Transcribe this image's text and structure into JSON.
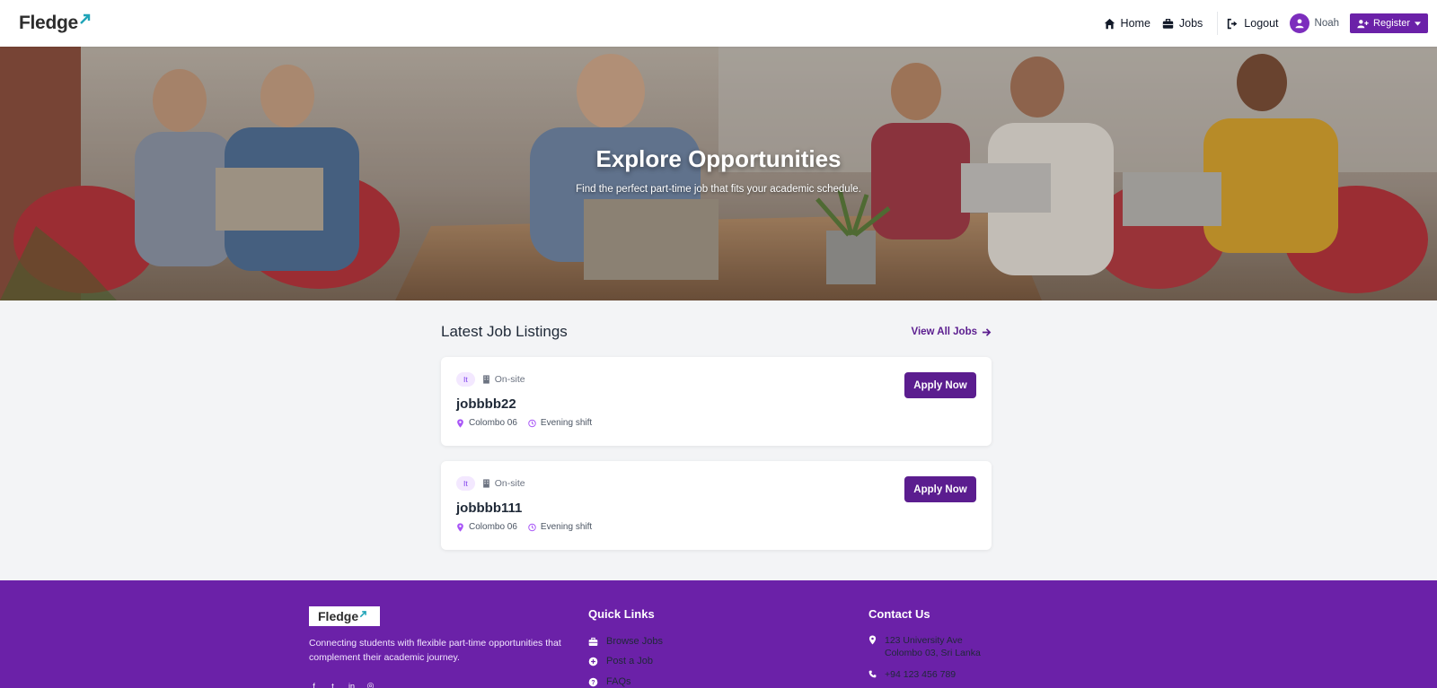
{
  "brand": {
    "name": "Fledge",
    "color": "#2d2d2d",
    "accent": "#20a4b8"
  },
  "nav": {
    "home_label": "Home",
    "jobs_label": "Jobs",
    "logout_label": "Logout",
    "user_name": "Noah",
    "register_label": "Register"
  },
  "hero": {
    "title": "Explore Opportunities",
    "subtitle": "Find the perfect part-time job that fits your academic schedule."
  },
  "listings": {
    "title": "Latest Job Listings",
    "view_all_label": "View All Jobs",
    "jobs": [
      {
        "category": "It",
        "mode": "On-site",
        "title": "jobbbb22",
        "location": "Colombo 06",
        "shift": "Evening shift",
        "apply_label": "Apply Now"
      },
      {
        "category": "It",
        "mode": "On-site",
        "title": "jobbbb111",
        "location": "Colombo 06",
        "shift": "Evening shift",
        "apply_label": "Apply Now"
      }
    ]
  },
  "footer": {
    "logo": "Fledge",
    "description": "Connecting students with flexible part-time opportunities that complement their academic journey.",
    "quick_links_title": "Quick Links",
    "quick_links": [
      "Browse Jobs",
      "Post a Job",
      "FAQs"
    ],
    "contact_title": "Contact Us",
    "address_line1": "123 University Ave",
    "address_line2": "Colombo 03, Sri Lanka",
    "phone": "+94 123 456 789"
  },
  "colors": {
    "primary": "#6b21a8",
    "button": "#5b1d8f",
    "badge_bg": "#f3e8ff",
    "page_bg": "#f3f4f6"
  }
}
